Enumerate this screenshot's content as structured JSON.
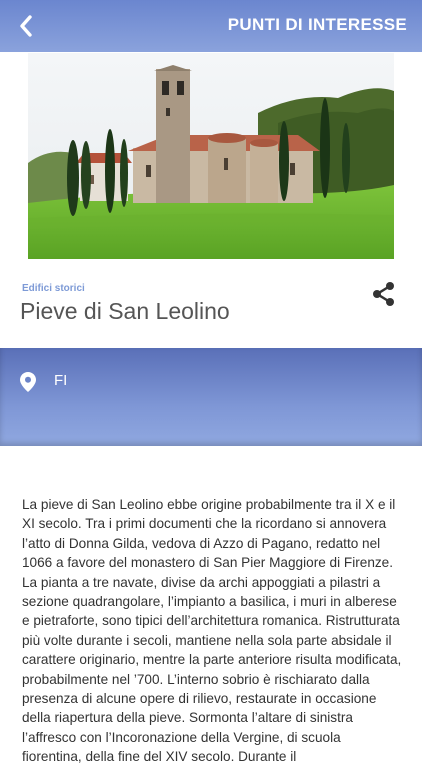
{
  "header": {
    "title": "PUNTI DI INTERESSE",
    "back_icon": "chevron-left-icon",
    "background": "#7a94d6"
  },
  "hero_image": {
    "subject": "Romanesque church with bell tower, cypress trees and green meadow"
  },
  "poi": {
    "category": "Edifici storici",
    "title": "Pieve di San Leolino",
    "share_icon": "share-icon"
  },
  "location": {
    "icon": "map-pin-icon",
    "province": "FI"
  },
  "description": "La pieve di San Leolino ebbe origine probabilmente tra il X e il XI secolo. Tra i primi documenti che la ricordano si annovera l’atto di Donna Gilda, vedova di Azzo di Pagano, redatto nel 1066 a favore del monastero di San Pier Maggiore di Firenze. La pianta a tre navate, divise da archi appoggiati a pilastri a sezione quadrangolare, l’impianto a basilica, i muri in alberese e pietraforte, sono tipici dell’architettura romanica. Ristrutturata più volte durante i secoli, mantiene nella sola parte absidale il carattere originario, mentre la parte anteriore risulta modificata, probabilmente nel ’700. L’interno sobrio è rischiarato dalla presenza di alcune opere di rilievo, restaurate in occasione della riapertura della pieve. Sormonta l’altare di sinistra l’affresco con l’Incoronazione della Vergine, di scuola fiorentina, della fine del XIV secolo. Durante il",
  "colors": {
    "accent": "#7a94d6",
    "category_text": "#7d9ad6",
    "title_text": "#555555"
  }
}
